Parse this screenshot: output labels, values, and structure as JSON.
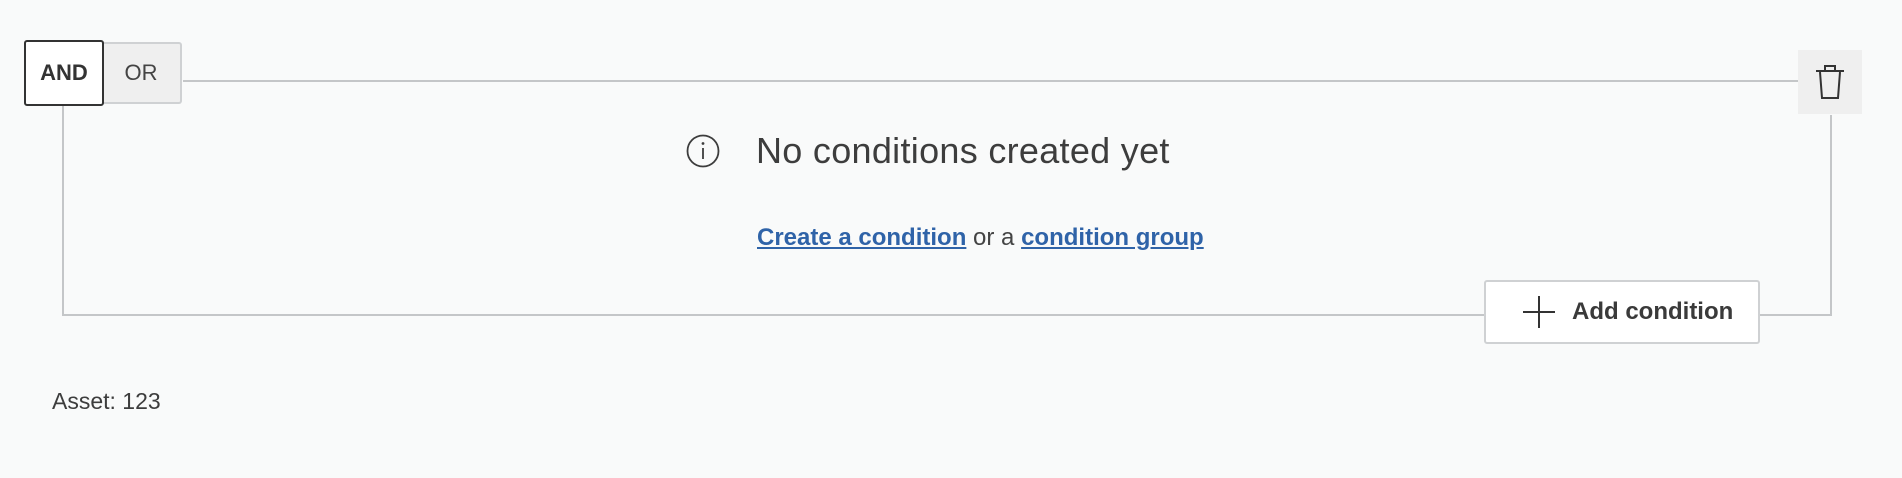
{
  "toggle": {
    "and_label": "AND",
    "or_label": "OR",
    "selected": "AND"
  },
  "empty_state": {
    "icon": "info-icon",
    "title": "No conditions created yet",
    "create_condition_link": "Create a condition",
    "connector_text": " or a ",
    "condition_group_link": "condition group"
  },
  "actions": {
    "add_condition_label": "Add condition",
    "add_icon": "plus-icon",
    "delete_icon": "trash-icon"
  },
  "asset": {
    "text": "Asset: 123"
  },
  "colors": {
    "background": "#f9fafa",
    "frame_line": "#c4c6c8",
    "link": "#2f63a8"
  }
}
